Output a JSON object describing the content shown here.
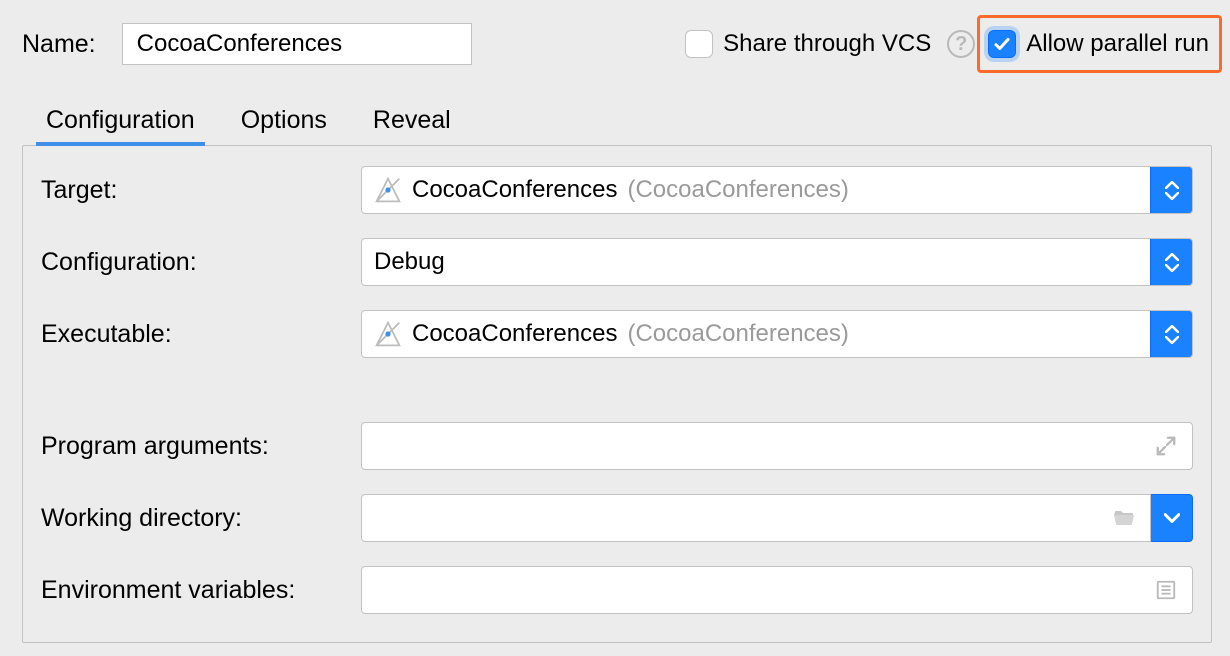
{
  "header": {
    "name_label": "Name:",
    "name_value": "CocoaConferences",
    "share_vcs_label": "Share through VCS",
    "share_vcs_checked": false,
    "help_tooltip": "?",
    "allow_parallel_label": "Allow parallel run",
    "allow_parallel_checked": true
  },
  "tabs": {
    "items": [
      "Configuration",
      "Options",
      "Reveal"
    ],
    "active_index": 0
  },
  "config": {
    "target": {
      "label": "Target:",
      "value_main": "CocoaConferences",
      "value_suffix": "(CocoaConferences)"
    },
    "configuration": {
      "label": "Configuration:",
      "value": "Debug"
    },
    "executable": {
      "label": "Executable:",
      "value_main": "CocoaConferences",
      "value_suffix": "(CocoaConferences)"
    },
    "program_args": {
      "label": "Program arguments:",
      "value": ""
    },
    "working_dir": {
      "label": "Working directory:",
      "value": ""
    },
    "env_vars": {
      "label": "Environment variables:",
      "value": ""
    }
  }
}
